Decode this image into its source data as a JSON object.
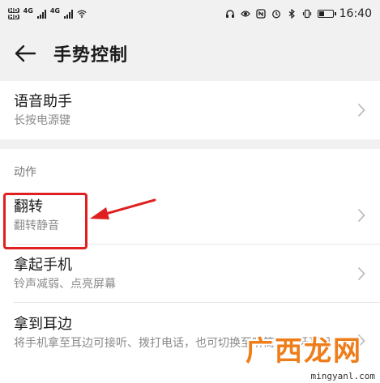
{
  "status_bar": {
    "hd1": "HD",
    "hd2": "HD",
    "net1": "4G",
    "net2": "4G",
    "time": "16:40",
    "icons": [
      "headset-icon",
      "eye-icon",
      "nfc-icon",
      "alarm-icon",
      "bluetooth-icon",
      "vibrate-icon",
      "battery-icon"
    ]
  },
  "header": {
    "title": "手势控制"
  },
  "voice_assistant": {
    "title": "语音助手",
    "subtitle": "长按电源键"
  },
  "actions_section": {
    "label": "动作",
    "items": [
      {
        "title": "翻转",
        "subtitle": "翻转静音"
      },
      {
        "title": "拿起手机",
        "subtitle": "铃声减弱、点亮屏幕"
      },
      {
        "title": "拿到耳边",
        "subtitle": "将手机拿至耳边可接听、拨打电话，也可切换至听筒或蓝牙耳机"
      }
    ]
  },
  "annotation": {
    "color": "#e02020"
  },
  "watermark": {
    "logo": "广西龙网",
    "url": "mingyanl.com"
  }
}
